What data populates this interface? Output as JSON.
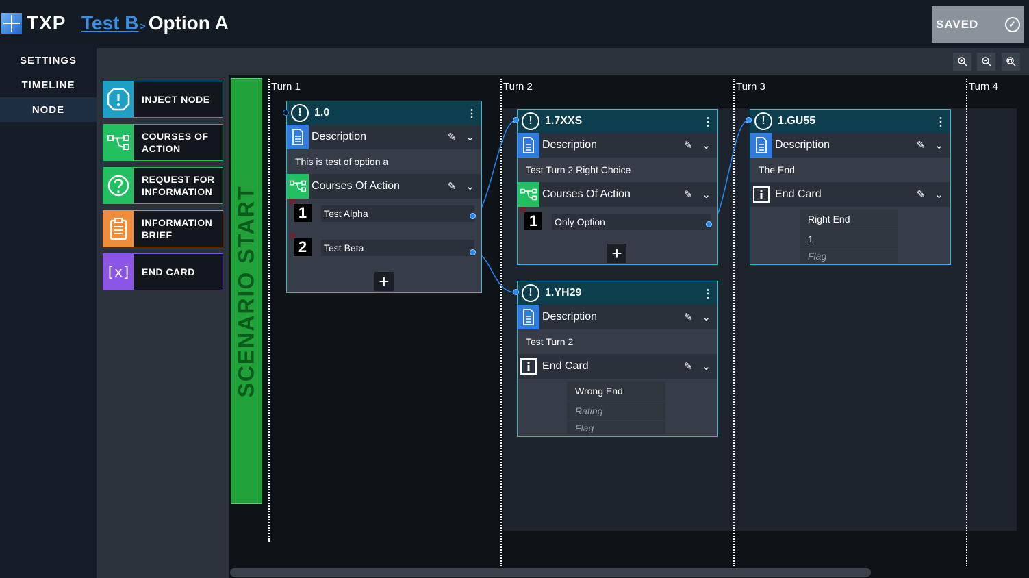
{
  "app": {
    "name": "TXP"
  },
  "breadcrumb": {
    "parent": "Test B",
    "separator": ">",
    "current": "Option A"
  },
  "status": {
    "label": "SAVED"
  },
  "nav": [
    "SETTINGS",
    "TIMELINE",
    "NODE"
  ],
  "palette": [
    {
      "label_line1": "INJECT NODE",
      "label_line2": "",
      "color": "#1ea0c6",
      "icon": "alert-icon"
    },
    {
      "label_line1": "COURSES OF",
      "label_line2": "ACTION",
      "color": "#22c060",
      "icon": "branch-icon"
    },
    {
      "label_line1": "REQUEST FOR",
      "label_line2": "INFORMATION",
      "color": "#22c060",
      "icon": "question-icon"
    },
    {
      "label_line1": "INFORMATION",
      "label_line2": "BRIEF",
      "color": "#f08d3a",
      "icon": "clipboard-icon"
    },
    {
      "label_line1": "END CARD",
      "label_line2": "",
      "color": "#8c55e6",
      "icon": "variable-icon"
    }
  ],
  "scenario_start": "SCENARIO START",
  "turns": [
    "Turn 1",
    "Turn 2",
    "Turn 3",
    "Turn 4"
  ],
  "sections": {
    "description": "Description",
    "coa": "Courses Of Action",
    "end_card": "End Card"
  },
  "nodes": {
    "n1": {
      "id": "1.0",
      "description": "This is test of option a",
      "options": [
        {
          "num": "1",
          "text": "Test Alpha"
        },
        {
          "num": "2",
          "text": "Test Beta"
        }
      ]
    },
    "n2": {
      "id": "1.7XXS",
      "description": "Test Turn 2 Right Choice",
      "options": [
        {
          "num": "1",
          "text": "Only Option"
        }
      ]
    },
    "n3": {
      "id": "1.GU55",
      "description": "The End",
      "end_card": {
        "title": "Right End",
        "rating": "1",
        "flag": "Flag"
      }
    },
    "n4": {
      "id": "1.YH29",
      "description": "Test Turn 2",
      "end_card": {
        "title": "Wrong End",
        "rating": "Rating",
        "flag": "Flag"
      }
    }
  },
  "colors": {
    "accent": "#3ab6d8",
    "green": "#21a139",
    "link": "#3d8fe0"
  }
}
